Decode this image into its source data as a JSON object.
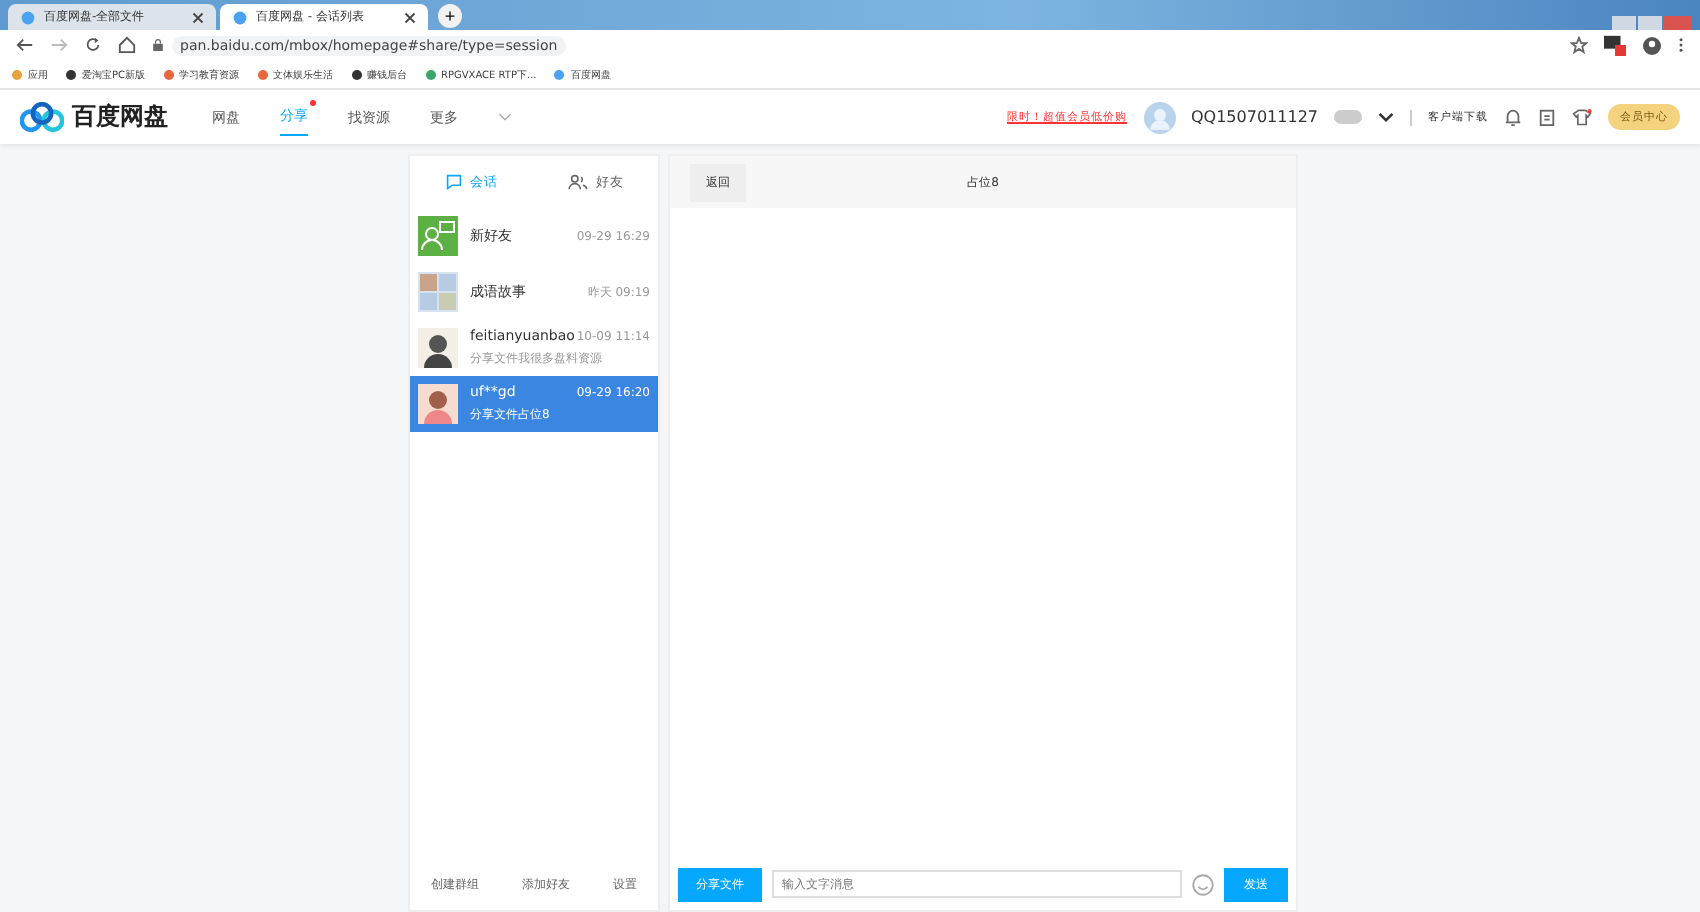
{
  "browser": {
    "tabs": [
      {
        "title": "百度网盘-全部文件",
        "selected": false
      },
      {
        "title": "百度网盘 - 会话列表",
        "selected": true
      }
    ],
    "new_tab": "+",
    "address": "pan.baidu.com/mbox/homepage#share/type=session",
    "bookmarks": [
      "应用",
      "爱淘宝PC新版",
      "学习教育资源",
      "文体娱乐生活",
      "赚钱后台",
      "RPGVXACE RTP下...",
      "百度网盘"
    ]
  },
  "header": {
    "logo": "百度网盘",
    "nav": [
      {
        "label": "网盘",
        "selected": false,
        "dot": false
      },
      {
        "label": "分享",
        "selected": true,
        "dot": true
      },
      {
        "label": "找资源",
        "selected": false,
        "dot": false
      },
      {
        "label": "更多",
        "selected": false,
        "dot": false
      }
    ],
    "promo": "限时！超值会员低价购",
    "user": "QQ1507011127",
    "client": "客户端下载",
    "member": "会员中心"
  },
  "sidebar": {
    "tabs": [
      {
        "label": "会话",
        "selected": true
      },
      {
        "label": "好友",
        "selected": false
      }
    ],
    "sessions": [
      {
        "name": "新好友",
        "time": "09-29 16:29",
        "selected": false,
        "kind": "friends"
      },
      {
        "name": "成语故事",
        "time": "昨天 09:19",
        "selected": false,
        "kind": "group"
      },
      {
        "name": "feitianyuanbao",
        "time": "10-09 11:14",
        "preview": "分享文件我很多盘料资源",
        "selected": false,
        "kind": "user"
      },
      {
        "name": "uf**gd",
        "time": "09-29 16:20",
        "preview": "分享文件占位8",
        "selected": true,
        "kind": "user"
      }
    ],
    "footer": [
      "创建群组",
      "添加好友",
      "设置"
    ]
  },
  "chat": {
    "back": "返回",
    "title": "占位8",
    "share_button": "分享文件",
    "input": {
      "placeholder": "输入文字消息"
    },
    "send": "发送"
  }
}
